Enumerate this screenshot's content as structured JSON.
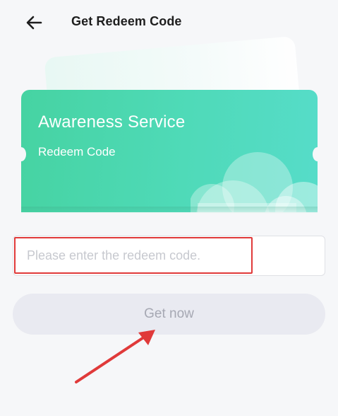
{
  "header": {
    "title": "Get Redeem Code",
    "back_icon": "arrow-left-icon"
  },
  "card": {
    "title": "Awareness Service",
    "subtitle": "Redeem Code",
    "colors": {
      "start": "#46d3a2",
      "end": "#56dcc9"
    },
    "decoration_icon": "cloud-icon"
  },
  "redeem_input": {
    "value": "",
    "placeholder": "Please enter the redeem code."
  },
  "get_now_button": {
    "label": "Get now",
    "disabled": true
  },
  "annotations": {
    "highlight_color": "#e03a3a"
  }
}
